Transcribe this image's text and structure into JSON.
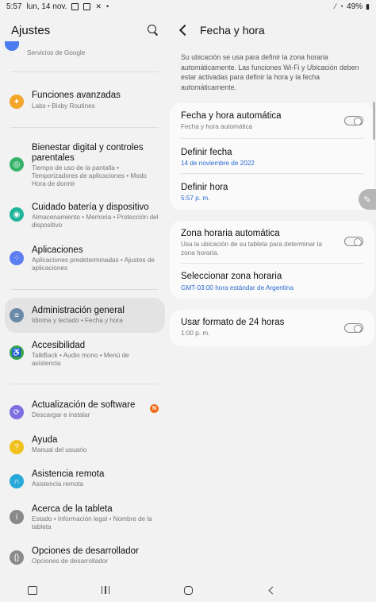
{
  "status_bar": {
    "time": "5:57",
    "date": "lun, 14 nov.",
    "battery": "49%"
  },
  "left_pane": {
    "title": "Ajustes",
    "partial_item_subtitle": "Servicios de Google",
    "items": [
      {
        "title": "Funciones avanzadas",
        "subtitle": "Labs  •  Bixby Routines",
        "icon": "star-gear-icon",
        "color": "#f4a62a"
      },
      {
        "title": "Bienestar digital y controles parentales",
        "subtitle": "Tiempo de uso de la pantalla  •  Temporizadores de aplicaciones  •  Modo Hora de dormir",
        "icon": "wellbeing-icon",
        "color": "#38b36a"
      },
      {
        "title": "Cuidado batería y dispositivo",
        "subtitle": "Almacenamiento  •  Memoria  •  Protección del dispositivo",
        "icon": "device-care-icon",
        "color": "#1fb59a"
      },
      {
        "title": "Aplicaciones",
        "subtitle": "Aplicaciones predeterminadas  •  Ajustes de aplicaciones",
        "icon": "apps-icon",
        "color": "#5d7ef0"
      },
      {
        "title": "Administración general",
        "subtitle": "Idioma y teclado  •  Fecha y hora",
        "icon": "sliders-icon",
        "color": "#6b8aa8"
      },
      {
        "title": "Accesibilidad",
        "subtitle": "TalkBack  •  Audio mono  •  Menú de asistencia",
        "icon": "accessibility-icon",
        "color": "#39a54c"
      },
      {
        "title": "Actualización de software",
        "subtitle": "Descargar e instalar",
        "icon": "software-update-icon",
        "color": "#7e6fe0",
        "badge": "N"
      },
      {
        "title": "Ayuda",
        "subtitle": "Manual del usuario",
        "icon": "help-icon",
        "color": "#f1c21e"
      },
      {
        "title": "Asistencia remota",
        "subtitle": "Asistencia remota",
        "icon": "headset-icon",
        "color": "#26a8d9"
      },
      {
        "title": "Acerca de la tableta",
        "subtitle": "Estado  •  Información legal  •  Nombre de la tableta",
        "icon": "info-icon",
        "color": "#8a8a8a"
      },
      {
        "title": "Opciones de desarrollador",
        "subtitle": "Opciones de desarrollador",
        "icon": "developer-braces-icon",
        "color": "#8a8a8a"
      }
    ]
  },
  "right_pane": {
    "title": "Fecha y hora",
    "description": "Su ubicación se usa para definir la zona horaria automáticamente. Las funciones Wi-Fi y Ubicación deben estar activadas para definir la hora y la fecha automáticamente.",
    "auto_datetime": {
      "title": "Fecha y hora automática",
      "subtitle": "Fecha y hora automática",
      "enabled": false
    },
    "set_date": {
      "title": "Definir fecha",
      "value": "14 de noviembre de 2022"
    },
    "set_time": {
      "title": "Definir hora",
      "value": "5:57 p. m."
    },
    "auto_timezone": {
      "title": "Zona horaria automática",
      "subtitle": "Usa la ubicación de su tableta para determinar la zona horaria.",
      "enabled": false
    },
    "select_timezone": {
      "title": "Seleccionar zona horaria",
      "value": "GMT-03:00 hora estándar de Argentina"
    },
    "format_24h": {
      "title": "Usar formato de 24 horas",
      "subtitle": "1:00 p. m.",
      "enabled": false
    }
  }
}
